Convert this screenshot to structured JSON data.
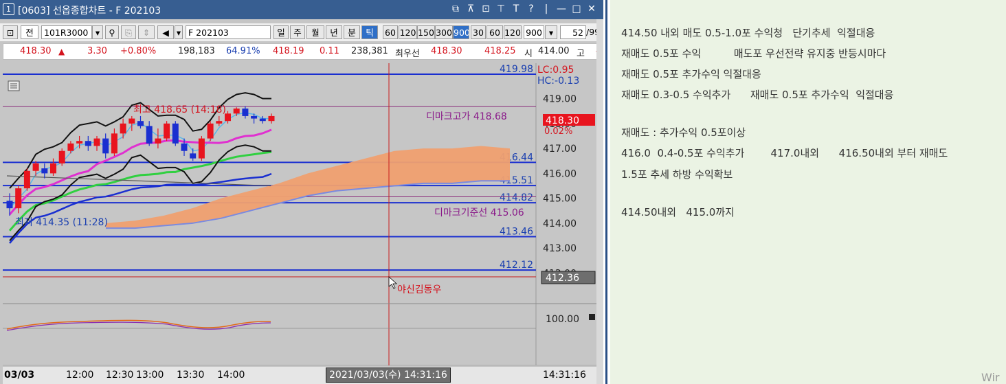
{
  "window": {
    "num": "1",
    "title": "[0603] 선옵종합차트 - F 202103",
    "icons": [
      "⧉",
      "⊼",
      "⊡",
      "⊤",
      "T",
      "?",
      "|",
      "—",
      "□",
      "✕"
    ]
  },
  "toolbar": {
    "code": "101R3000",
    "jeon": "전",
    "symbol": "F 202103",
    "periods": [
      "일",
      "주",
      "월",
      "년",
      "분",
      "틱"
    ],
    "intervals": [
      "60",
      "120",
      "150",
      "300",
      "900",
      "30",
      "60",
      "120"
    ],
    "count_select": "900",
    "count": "52",
    "count_suffix": "/99"
  },
  "quote": {
    "price": "418.30",
    "up_arrow": "▲",
    "change": "3.30",
    "change_pct": "+0.80%",
    "volume": "198,183",
    "ratio": "64.91%",
    "p2": "418.19",
    "p3": "0.11",
    "vol2": "238,381",
    "best_label": "최우선",
    "best_ask": "418.30",
    "best_bid": "418.25",
    "open_label": "시",
    "open_val": "414.00",
    "high_label": "고",
    "high_val": "4"
  },
  "chart_data": {
    "type": "candlestick",
    "y_range": [
      411.6,
      420.2
    ],
    "y_ticks": [
      "419.00",
      "418.00",
      "417.00",
      "416.00",
      "415.00",
      "414.00",
      "413.00",
      "412.00"
    ],
    "levels": [
      {
        "label": "419.98",
        "value": 419.98
      },
      {
        "label": "416.44",
        "value": 416.44
      },
      {
        "label": "415.51",
        "value": 415.51
      },
      {
        "label": "414.82",
        "value": 414.82
      },
      {
        "label": "413.46",
        "value": 413.46
      },
      {
        "label": "412.12",
        "value": 412.12
      }
    ],
    "lc": "LC:0.95",
    "hc": "HC:-0.13",
    "high_annot": "최고 418.65 (14:18)",
    "low_annot": "최저 414.35 (11:28)",
    "dimark_high": "디마크고가 418.68",
    "dimark_base": "디마크기준선 415.06",
    "current_price": "418.30",
    "current_pct": "0.02%",
    "cursor_price": "412.36",
    "cursor_label": "야신김동우",
    "sub_label": "100.00",
    "candles": [
      [
        414.9,
        414.6,
        415.2,
        414.3
      ],
      [
        414.6,
        415.4,
        415.5,
        414.4
      ],
      [
        415.4,
        416.1,
        416.2,
        415.3
      ],
      [
        416.1,
        416.4,
        416.5,
        415.9
      ],
      [
        416.2,
        416.0,
        416.4,
        415.8
      ],
      [
        416.0,
        416.4,
        416.6,
        415.9
      ],
      [
        416.4,
        416.9,
        417.0,
        416.3
      ],
      [
        416.9,
        417.2,
        417.3,
        416.8
      ],
      [
        417.2,
        417.3,
        417.5,
        417.0
      ],
      [
        417.3,
        417.1,
        417.5,
        416.9
      ],
      [
        417.1,
        417.4,
        417.5,
        416.9
      ],
      [
        417.4,
        416.8,
        417.6,
        416.6
      ],
      [
        416.8,
        417.6,
        417.8,
        416.7
      ],
      [
        417.6,
        418.0,
        418.2,
        417.4
      ],
      [
        418.0,
        418.2,
        418.3,
        417.7
      ],
      [
        418.1,
        417.9,
        418.3,
        417.8
      ],
      [
        417.9,
        417.2,
        418.1,
        417.1
      ],
      [
        417.2,
        417.4,
        417.8,
        417.0
      ],
      [
        417.4,
        418.0,
        418.1,
        417.3
      ],
      [
        418.0,
        417.2,
        418.1,
        417.1
      ],
      [
        417.2,
        416.9,
        417.4,
        416.7
      ],
      [
        416.8,
        416.6,
        417.0,
        416.5
      ],
      [
        416.6,
        417.4,
        417.5,
        416.5
      ],
      [
        417.4,
        418.0,
        418.1,
        417.3
      ],
      [
        418.0,
        418.1,
        418.3,
        417.9
      ],
      [
        418.1,
        418.4,
        418.5,
        418.0
      ],
      [
        418.4,
        418.6,
        418.65,
        418.3
      ],
      [
        418.6,
        418.3,
        418.7,
        418.2
      ],
      [
        418.3,
        418.2,
        418.4,
        418.0
      ],
      [
        418.2,
        418.1,
        418.3,
        418.0
      ],
      [
        418.1,
        418.3,
        418.4,
        418.0
      ]
    ]
  },
  "time_axis": {
    "date": "03/03",
    "ticks": [
      "12:00",
      "12:30",
      "13:00",
      "13:30",
      "14:00"
    ],
    "cursor_time": "2021/03/03(수) 14:31:16",
    "current_time": "14:31:16"
  },
  "notes": [
    "414.50 내외 매도 0.5-1.0포 수익청   단기추세  익절대응",
    "재매도 0.5포 수익          매도포 우선전략 유지중 반등시마다",
    "재매도 0.5포 추가수익 익절대응",
    "재매도 0.3-0.5 수익추가      재매도 0.5포 추가수익  익절대응",
    "재매도 : 추가수익 0.5포이상",
    "416.0  0.4-0.5포 수익추가        417.0내외      416.50내외 부터 재매도",
    "1.5포 추세 하방 수익확보",
    "414.50내외   415.0까지"
  ],
  "watermark": "Wir"
}
